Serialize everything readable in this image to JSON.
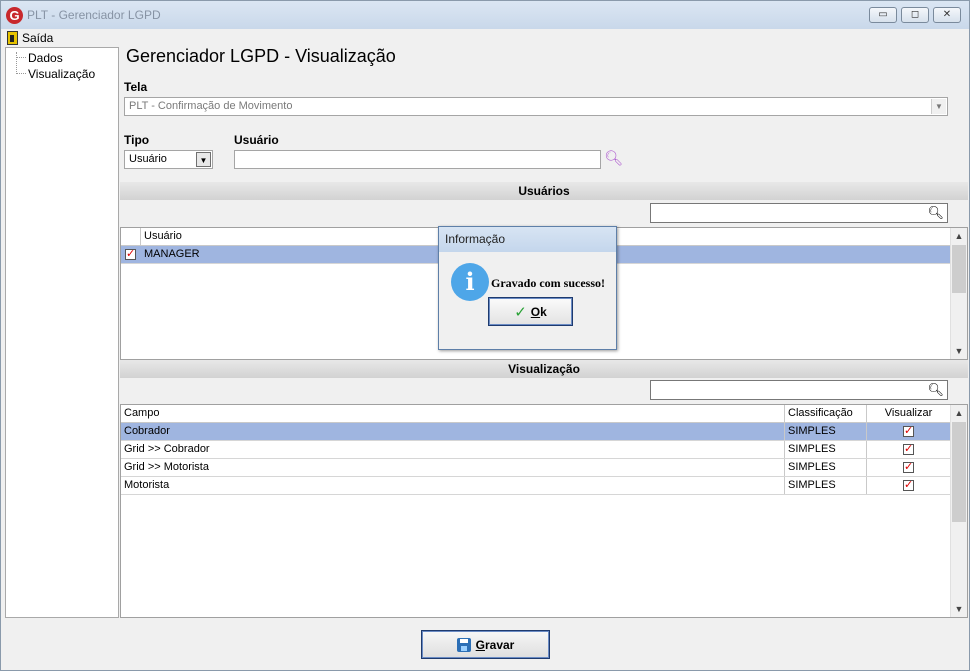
{
  "window": {
    "title": "PLT - Gerenciador LGPD",
    "app_icon_letter": "G",
    "minimize_label": "▭",
    "maximize_label": "◻",
    "close_label": "✕"
  },
  "menu": {
    "exit_label": "Saída"
  },
  "tree": {
    "items": [
      {
        "label": "Dados"
      },
      {
        "label": "Visualização"
      }
    ]
  },
  "page": {
    "heading": "Gerenciador LGPD - Visualização"
  },
  "form": {
    "tela_label": "Tela",
    "tela_value": "PLT - Confirmação de Movimento",
    "tipo_label": "Tipo",
    "tipo_value": "Usuário",
    "usuario_label": "Usuário",
    "usuario_value": ""
  },
  "users_section": {
    "title": "Usuários",
    "filter_value": "",
    "columns": [
      "Usuário"
    ],
    "rows": [
      {
        "name": "MANAGER",
        "checked": true,
        "selected": true
      }
    ]
  },
  "view_section": {
    "title": "Visualização",
    "filter_value": "",
    "columns": [
      "Campo",
      "Classificação",
      "Visualizar"
    ],
    "rows": [
      {
        "campo": "Cobrador",
        "classificacao": "SIMPLES",
        "visualizar": true,
        "selected": true
      },
      {
        "campo": "Grid >> Cobrador",
        "classificacao": "SIMPLES",
        "visualizar": true,
        "selected": false
      },
      {
        "campo": "Grid >> Motorista",
        "classificacao": "SIMPLES",
        "visualizar": true,
        "selected": false
      },
      {
        "campo": "Motorista",
        "classificacao": "SIMPLES",
        "visualizar": true,
        "selected": false
      }
    ]
  },
  "save_button": {
    "label": "Gravar",
    "access_key": "G",
    "label_rest": "ravar"
  },
  "dialog": {
    "title": "Informação",
    "message": "Gravado com sucesso!",
    "ok_key": "O",
    "ok_rest": "k"
  },
  "colors": {
    "selection": "#9fb5e0",
    "title_bar": "#c9d8ea",
    "check_red": "#dd0000",
    "info_blue": "#4ea6e8"
  },
  "icons": {
    "app": "app-logo-icon",
    "exit": "exit-door-icon",
    "search": "search-icon",
    "filter": "magnifier-icon",
    "save": "floppy-disk-icon",
    "info": "info-icon",
    "ok": "checkmark-icon"
  }
}
